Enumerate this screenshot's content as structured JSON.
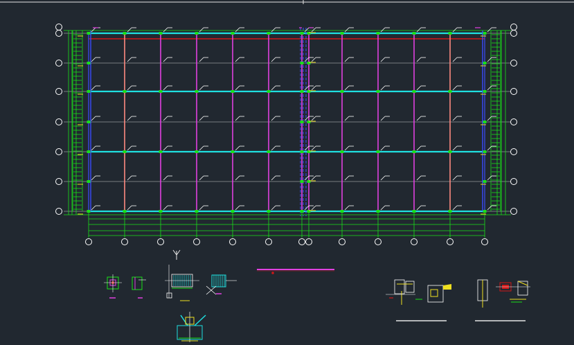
{
  "drawing": {
    "background": "#212830",
    "colors": {
      "frame": "#e6e6e6",
      "grid_line": "#cfcfcf",
      "dimension_green": "#19e019",
      "rafter_cyan": "#1fe0e0",
      "column_magenta": "#e040e0",
      "column_salmon": "#ff8a80",
      "brace_red": "#d01818",
      "yellow": "#f0e020",
      "blue": "#3a4cff",
      "white": "#ffffff",
      "orange": "#ff9a20"
    },
    "icons": {
      "axis_bubble": "circle-grid-bubble-icon",
      "ucs": "ucs-y-axis-icon"
    },
    "ucs_axis_label": "Y",
    "plan": {
      "vertical_grid_count": 12,
      "horizontal_grid_count": 7
    },
    "details": [
      "column-base-detail",
      "anchor-bolt-detail",
      "purlin-connection-detail",
      "brace-connection-detail",
      "ridge-connection-detail",
      "eave-gutter-detail",
      "gable-end-detail"
    ]
  }
}
